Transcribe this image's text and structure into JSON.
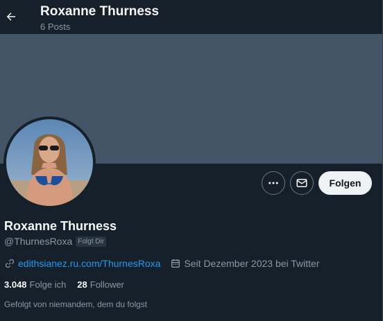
{
  "header": {
    "name": "Roxanne Thurness",
    "posts": "6 Posts"
  },
  "actions": {
    "follow_label": "Folgen"
  },
  "profile": {
    "name": "Roxanne Thurness",
    "handle": "@ThurnesRoxa",
    "follows_you": "Folgt Dir",
    "website": "edithsianez.ru.com/ThurnesRoxa",
    "joined": "Seit Dezember 2023 bei Twitter",
    "following_count": "3.048",
    "following_label": "Folge ich",
    "followers_count": "28",
    "followers_label": "Follower",
    "followed_by": "Gefolgt von niemandem, dem du folgst"
  },
  "colors": {
    "background": "#15202b",
    "banner": "#425466",
    "link": "#1d9bf0",
    "muted": "#8b98a5"
  },
  "icons": {
    "back": "arrow-left-icon",
    "more": "more-icon",
    "message": "envelope-icon",
    "link": "link-icon",
    "calendar": "calendar-icon"
  }
}
